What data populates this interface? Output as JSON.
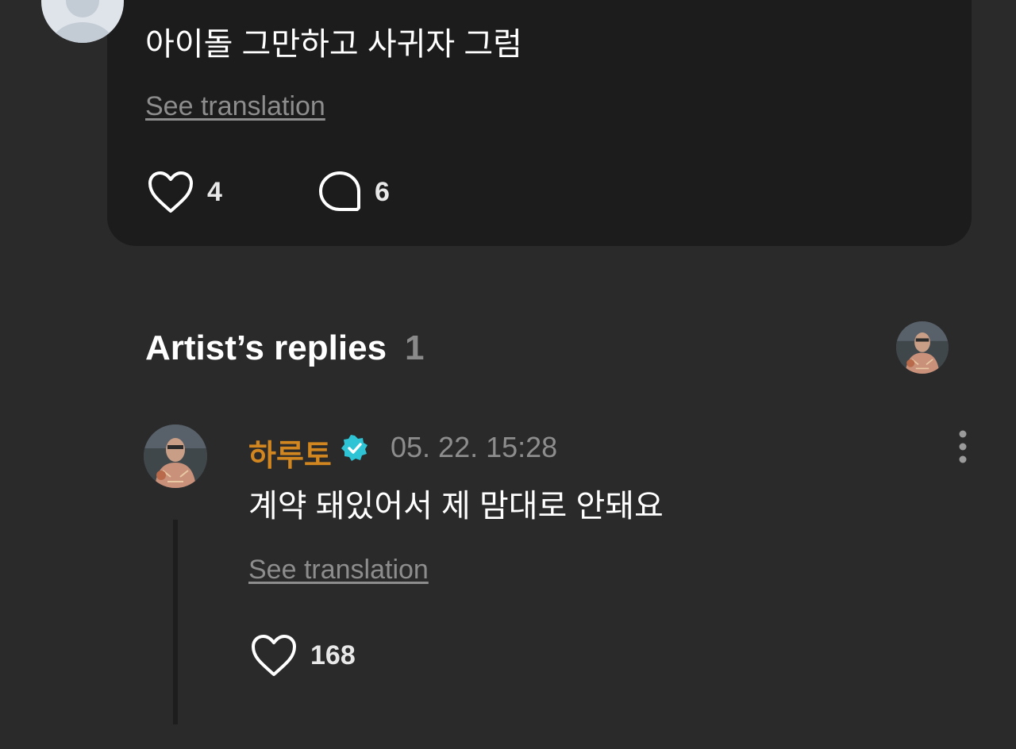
{
  "post": {
    "text": "아이돌 그만하고 사귀자 그럼",
    "see_translation": "See translation",
    "like_count": "4",
    "comment_count": "6"
  },
  "artist_replies": {
    "title": "Artist’s replies",
    "count": "1"
  },
  "reply": {
    "author": "하루토",
    "timestamp": "05. 22. 15:28",
    "text": "계약 돼있어서 제 맘대로 안돼요",
    "see_translation": "See translation",
    "like_count": "168"
  },
  "colors": {
    "background": "#2a2a2a",
    "card": "#1c1c1c",
    "author_name": "#d1861f",
    "verified_badge": "#2ec4d6",
    "muted_text": "#8d8d8d"
  },
  "icons": {
    "like": "heart-outline-icon",
    "comment": "speech-bubble-icon",
    "verified": "verified-badge-icon",
    "more": "vertical-dots-icon"
  }
}
